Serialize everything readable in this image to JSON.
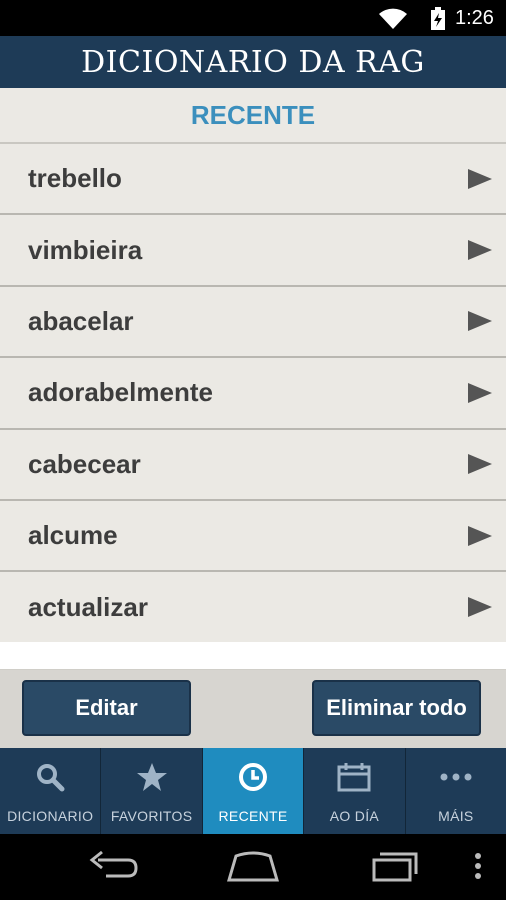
{
  "status_bar": {
    "time": "1:26"
  },
  "header": {
    "title": "DICIONARIO DA RAG"
  },
  "section": {
    "title": "RECENTE"
  },
  "words": [
    {
      "label": "trebello"
    },
    {
      "label": "vimbieira"
    },
    {
      "label": "abacelar"
    },
    {
      "label": "adorabelmente"
    },
    {
      "label": "cabecear"
    },
    {
      "label": "alcume"
    },
    {
      "label": "actualizar"
    }
  ],
  "actions": {
    "edit_label": "Editar",
    "delete_all_label": "Eliminar todo"
  },
  "tabs": [
    {
      "label": "DICIONARIO",
      "icon": "search-icon"
    },
    {
      "label": "FAVORITOS",
      "icon": "star-icon"
    },
    {
      "label": "RECENTE",
      "icon": "clock-icon",
      "active": true
    },
    {
      "label": "AO DÍA",
      "icon": "calendar-icon"
    },
    {
      "label": "MÁIS",
      "icon": "more-icon"
    }
  ],
  "colors": {
    "header": "#1e3b57",
    "accent": "#3b8fbd",
    "active_tab": "#1f8cbf",
    "button": "#2a4a66"
  }
}
